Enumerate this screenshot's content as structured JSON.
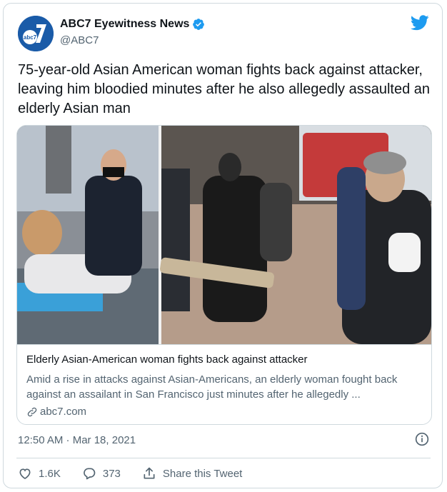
{
  "account": {
    "display_name": "ABC7 Eyewitness News",
    "handle": "@ABC7",
    "verified": true,
    "avatar_icon": "abc7-logo-icon",
    "avatar_text": "abc7"
  },
  "tweet": {
    "text": "75-year-old Asian American woman fights back against attacker, leaving him bloodied minutes after he also allegedly assaulted an elderly Asian man",
    "timestamp": "12:50 AM · Mar 18, 2021"
  },
  "link_card": {
    "title": "Elderly Asian-American woman fights back against attacker",
    "description": "Amid a rise in attacks against Asian-Americans, an elderly woman fought back against an assailant in San Francisco just minutes after he allegedly ...",
    "domain": "abc7.com",
    "image_icon": "news-photo-image"
  },
  "actions": {
    "likes": "1.6K",
    "replies": "373",
    "share_label": "Share this Tweet"
  },
  "icons": {
    "brand": "twitter-bird-icon",
    "verified": "verified-badge-icon",
    "info": "info-icon",
    "like": "heart-icon",
    "reply": "reply-icon",
    "share": "share-icon",
    "link": "link-icon"
  },
  "colors": {
    "twitter_blue": "#1d9bf0",
    "text_primary": "#0f1419",
    "text_secondary": "#536471",
    "border": "#cfd9de",
    "abc_blue": "#1a5ba8"
  }
}
